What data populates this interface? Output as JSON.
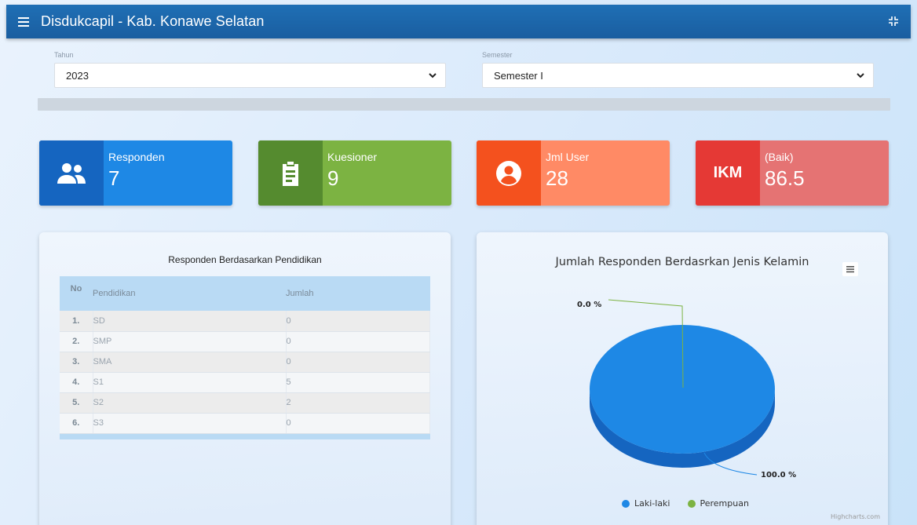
{
  "header": {
    "title": "Disdukcapil - Kab. Konawe Selatan",
    "menu_icon": "hamburger-icon",
    "fullscreen_icon": "collapse-icon"
  },
  "filters": {
    "tahun": {
      "label": "Tahun",
      "value": "2023"
    },
    "semester": {
      "label": "Semester",
      "value": "Semester I"
    }
  },
  "stats": [
    {
      "label": "Responden",
      "value": "7",
      "icon": "users-icon",
      "color_dark": "#1565c0",
      "color": "#1e88e5"
    },
    {
      "label": "Kuesioner",
      "value": "9",
      "icon": "clipboard-icon",
      "color_dark": "#558b2f",
      "color": "#7cb342"
    },
    {
      "label": "Jml User",
      "value": "28",
      "icon": "user-circle-icon",
      "color_dark": "#f4511e",
      "color": "#ff8a65"
    },
    {
      "label": "(Baik)",
      "value": "86.5",
      "icon_text": "IKM",
      "color_dark": "#e53935",
      "color": "#e57373"
    }
  ],
  "education_table": {
    "title": "Responden Berdasarkan Pendidikan",
    "headers": [
      "No",
      "Pendidikan",
      "Jumlah"
    ],
    "rows": [
      {
        "no": "1.",
        "pendidikan": "SD",
        "jumlah": "0"
      },
      {
        "no": "2.",
        "pendidikan": "SMP",
        "jumlah": "0"
      },
      {
        "no": "3.",
        "pendidikan": "SMA",
        "jumlah": "0"
      },
      {
        "no": "4.",
        "pendidikan": "S1",
        "jumlah": "5"
      },
      {
        "no": "5.",
        "pendidikan": "S2",
        "jumlah": "2"
      },
      {
        "no": "6.",
        "pendidikan": "S3",
        "jumlah": "0"
      }
    ]
  },
  "chart_data": {
    "type": "pie",
    "title": "Jumlah Responden Berdasrkan Jenis Kelamin",
    "series": [
      {
        "name": "Laki-laki",
        "value": 100.0,
        "label": "100.0 %",
        "color": "#1e88e5"
      },
      {
        "name": "Perempuan",
        "value": 0.0,
        "label": "0.0 %",
        "color": "#7cb342"
      }
    ],
    "legend": "bottom",
    "credit": "Highcharts.com"
  }
}
